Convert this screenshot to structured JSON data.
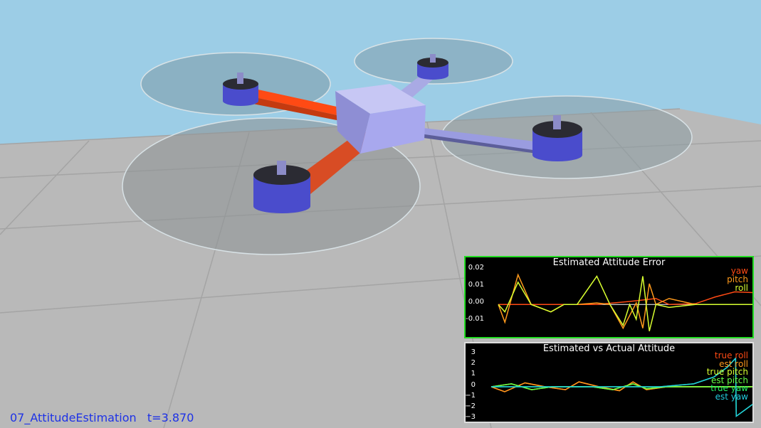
{
  "status": {
    "scenario": "07_AttitudeEstimation",
    "time": "t=3.870"
  },
  "colors": {
    "sky": "#9ccde6",
    "floor": "#b9b9b9",
    "arm_front": "#e44014",
    "arm_back": "#9a9ce0",
    "body": "#a8a8ee",
    "motor": "#4a4ccc",
    "status_text": "#1e32e6"
  },
  "panel1": {
    "title": "Estimated Attitude Error",
    "border_color": "#22dd22",
    "yticks": [
      "0.02",
      "0.01",
      "0.00",
      "-0.01"
    ],
    "legend": [
      {
        "label": "yaw",
        "color": "#ff4a14"
      },
      {
        "label": "pitch",
        "color": "#ff9a1c"
      },
      {
        "label": "roll",
        "color": "#d8ff30"
      }
    ],
    "chart_data": {
      "type": "line",
      "title": "Estimated Attitude Error",
      "ylim": [
        -0.02,
        0.025
      ],
      "xlim": [
        0,
        3.87
      ],
      "series": [
        {
          "name": "yaw",
          "x": [
            0,
            1.5,
            2.0,
            2.4,
            2.6,
            3.0,
            3.3,
            3.6,
            3.87
          ],
          "y": [
            0.0,
            0.0,
            0.002,
            0.004,
            0.0,
            0.0005,
            0.005,
            0.0085,
            0.008
          ]
        },
        {
          "name": "pitch",
          "x": [
            0,
            0.1,
            0.3,
            0.5,
            0.8,
            1.0,
            1.2,
            1.5,
            1.7,
            1.9,
            2.1,
            2.2,
            2.3,
            2.4,
            2.6,
            3.0,
            3.87
          ],
          "y": [
            0.0,
            -0.012,
            0.02,
            0.0,
            -0.005,
            0.0,
            0.0,
            0.001,
            0.0,
            -0.016,
            0.001,
            -0.016,
            0.014,
            0.0,
            0.004,
            0.0,
            0.0
          ]
        },
        {
          "name": "roll",
          "x": [
            0,
            0.1,
            0.3,
            0.5,
            0.8,
            1.0,
            1.2,
            1.5,
            1.7,
            1.9,
            2.0,
            2.1,
            2.2,
            2.3,
            2.4,
            2.6,
            3.0,
            3.87
          ],
          "y": [
            0.0,
            -0.005,
            0.015,
            0.0,
            -0.005,
            0.0,
            0.0,
            0.019,
            0.0,
            -0.014,
            0.0,
            -0.01,
            0.019,
            -0.018,
            0.0,
            -0.002,
            0.0,
            0.0
          ]
        }
      ]
    }
  },
  "panel2": {
    "title": "Estimated vs Actual Attitude",
    "border_color": "#dddddd",
    "yticks": [
      "3",
      "2",
      "1",
      "0",
      "−1",
      "−2",
      "−3"
    ],
    "legend": [
      {
        "label": "true roll",
        "color": "#ff4a14"
      },
      {
        "label": "est roll",
        "color": "#ff9a1c"
      },
      {
        "label": "true pitch",
        "color": "#d8ff30"
      },
      {
        "label": "est pitch",
        "color": "#66ff44"
      },
      {
        "label": "true yaw",
        "color": "#22ee66"
      },
      {
        "label": "est yaw",
        "color": "#22ccdd"
      }
    ],
    "chart_data": {
      "type": "line",
      "title": "Estimated vs Actual Attitude",
      "ylim": [
        -3.4,
        3.4
      ],
      "xlim": [
        0,
        3.87
      ],
      "series": [
        {
          "name": "true roll",
          "x": [
            0,
            0.2,
            0.5,
            0.8,
            1.1,
            1.3,
            1.6,
            1.9,
            2.1,
            2.3,
            2.6,
            3.87
          ],
          "y": [
            0,
            -0.5,
            0.4,
            0,
            -0.3,
            0.5,
            0,
            -0.4,
            0.5,
            -0.3,
            0,
            0
          ]
        },
        {
          "name": "est roll",
          "x": [
            0,
            0.2,
            0.5,
            0.8,
            1.1,
            1.3,
            1.6,
            1.9,
            2.1,
            2.3,
            2.6,
            3.87
          ],
          "y": [
            0,
            -0.5,
            0.4,
            0,
            -0.3,
            0.5,
            0,
            -0.4,
            0.5,
            -0.3,
            0,
            0
          ]
        },
        {
          "name": "true pitch",
          "x": [
            0,
            0.3,
            0.6,
            0.9,
            1.5,
            1.8,
            2.1,
            2.3,
            2.6,
            3.87
          ],
          "y": [
            0,
            0.3,
            -0.3,
            0,
            0,
            -0.3,
            0.3,
            -0.2,
            0,
            0
          ]
        },
        {
          "name": "est pitch",
          "x": [
            0,
            0.3,
            0.6,
            0.9,
            1.5,
            1.8,
            2.1,
            2.3,
            2.6,
            3.87
          ],
          "y": [
            0,
            0.3,
            -0.3,
            0,
            0,
            -0.3,
            0.3,
            -0.2,
            0,
            0
          ]
        },
        {
          "name": "true yaw",
          "x": [
            0,
            2.5,
            3.0,
            3.3,
            3.5,
            3.62,
            3.63,
            3.87
          ],
          "y": [
            0,
            0,
            0.3,
            1.0,
            2.0,
            2.9,
            -3.0,
            -1.8
          ]
        },
        {
          "name": "est yaw",
          "x": [
            0,
            2.5,
            3.0,
            3.3,
            3.5,
            3.62,
            3.63,
            3.87
          ],
          "y": [
            0,
            0,
            0.3,
            1.0,
            2.0,
            2.9,
            -3.0,
            -1.8
          ]
        }
      ]
    }
  }
}
